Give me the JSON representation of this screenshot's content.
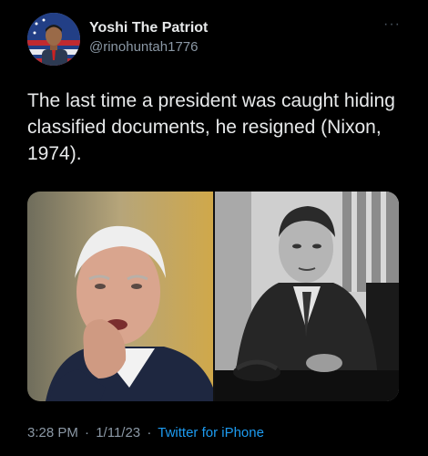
{
  "author": {
    "display_name": "Yoshi The Patriot",
    "handle": "@rinohuntah1776"
  },
  "tweet": {
    "text": "The last time a president was caught hiding classified documents, he resigned (Nixon, 1974)."
  },
  "meta": {
    "time": "3:28 PM",
    "date": "1/11/23",
    "separator": "·",
    "source": "Twitter for iPhone"
  },
  "icons": {
    "more": "more-options-icon"
  },
  "colors": {
    "background": "#000000",
    "text": "#e7e9ea",
    "secondary": "#8b98a5",
    "link": "#1d9bf0"
  }
}
